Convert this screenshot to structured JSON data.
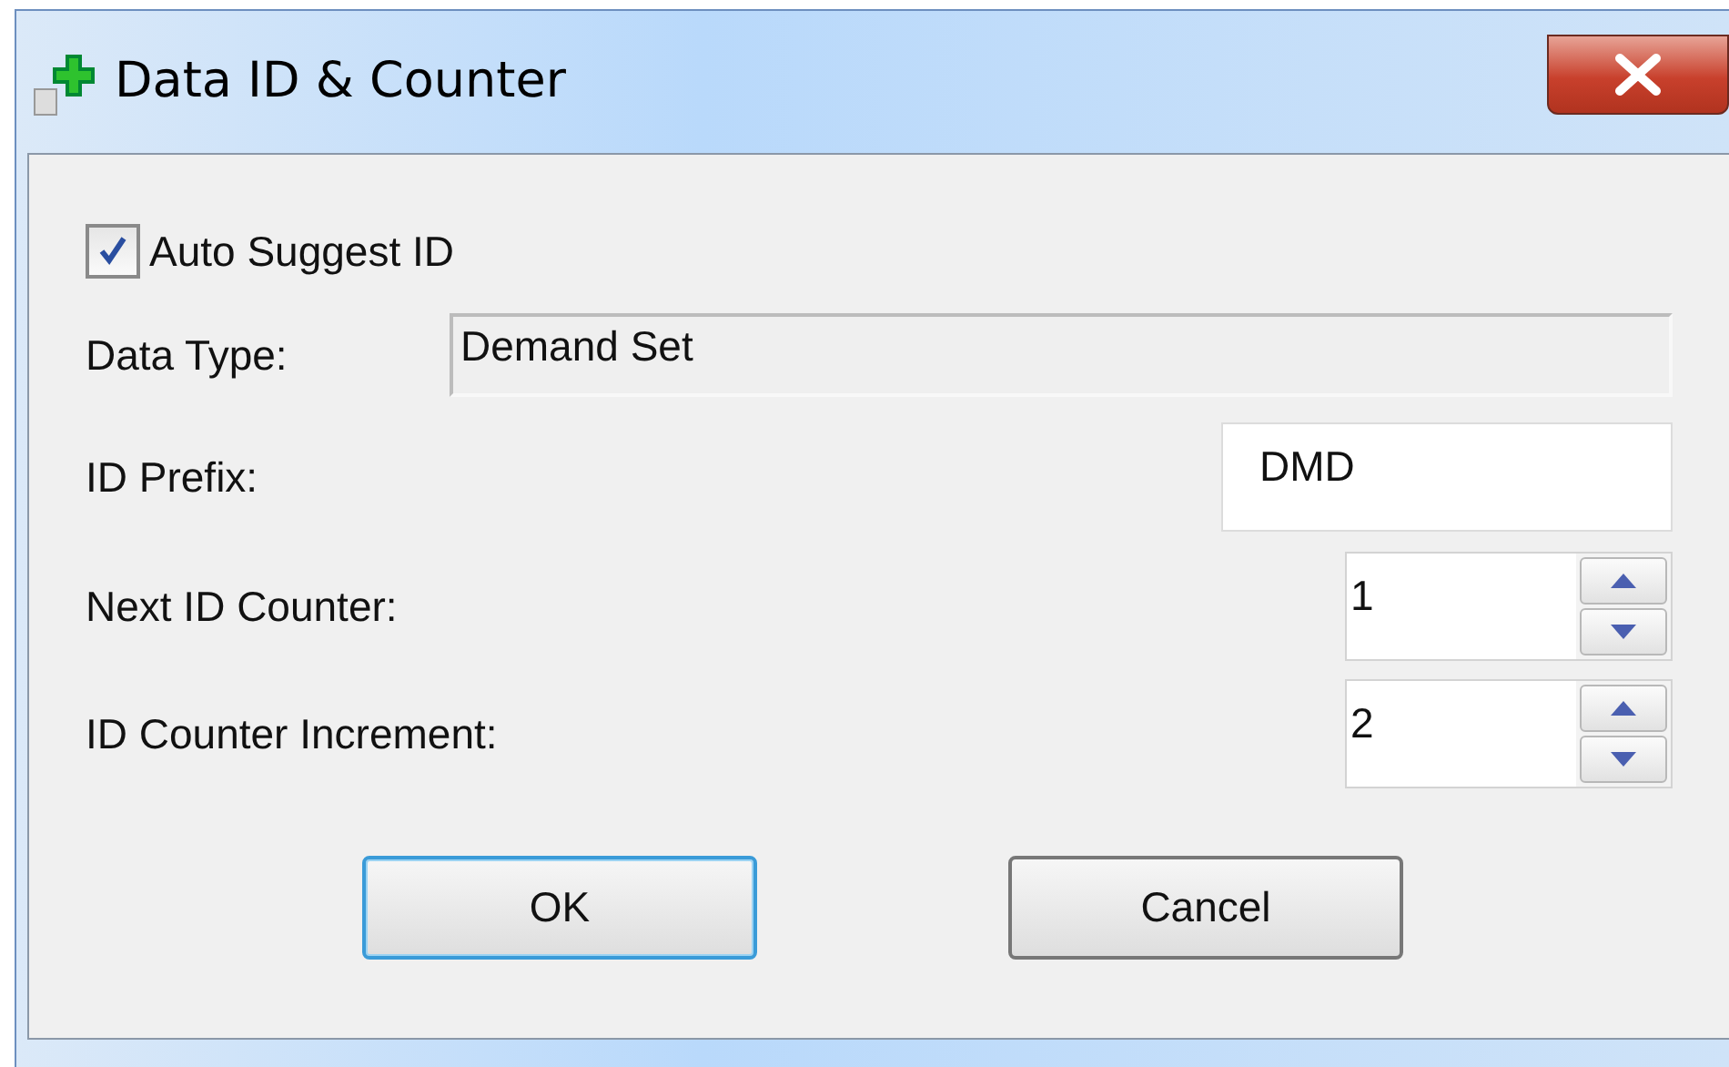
{
  "window": {
    "title": "Data ID & Counter"
  },
  "fields": [
    {
      "kind": "checkbox",
      "label": "Auto Suggest ID",
      "checked": true
    },
    {
      "kind": "readonly",
      "label": "Data Type:",
      "value": "Demand Set"
    },
    {
      "kind": "text",
      "label": "ID Prefix:",
      "value": "DMD"
    },
    {
      "kind": "spinner",
      "label": "Next ID Counter:",
      "value": "1"
    },
    {
      "kind": "spinner",
      "label": "ID Counter Increment:",
      "value": "2"
    }
  ],
  "buttons": [
    {
      "label": "OK",
      "default": true
    },
    {
      "label": "Cancel",
      "default": false
    }
  ]
}
